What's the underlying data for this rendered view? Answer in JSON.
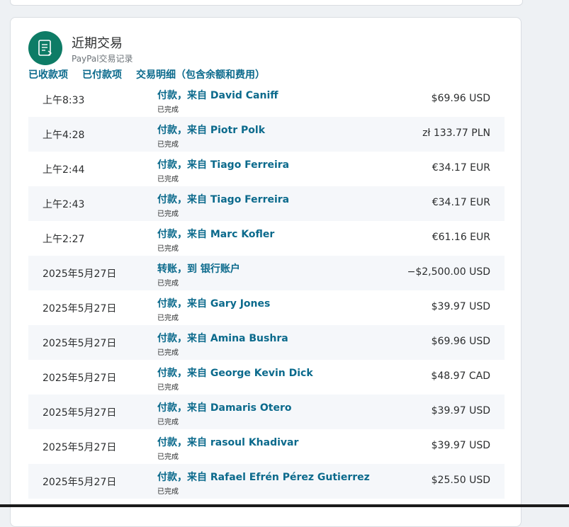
{
  "card": {
    "title": "近期交易",
    "subtitle": "PayPal交易记录",
    "icon": "document-icon"
  },
  "tabs": [
    {
      "label": "已收款项"
    },
    {
      "label": "已付款项"
    },
    {
      "label": "交易明细（包含余额和费用）"
    }
  ],
  "transactions": [
    {
      "date": "上午8:33",
      "description": "付款，来自 David Caniff",
      "status": "已完成",
      "amount": "$69.96 USD"
    },
    {
      "date": "上午4:28",
      "description": "付款，来自 Piotr Polk",
      "status": "已完成",
      "amount": "zł 133.77 PLN"
    },
    {
      "date": "上午2:44",
      "description": "付款，来自 Tiago Ferreira",
      "status": "已完成",
      "amount": "€34.17 EUR"
    },
    {
      "date": "上午2:43",
      "description": "付款，来自 Tiago Ferreira",
      "status": "已完成",
      "amount": "€34.17 EUR"
    },
    {
      "date": "上午2:27",
      "description": "付款，来自 Marc Kofler",
      "status": "已完成",
      "amount": "€61.16 EUR"
    },
    {
      "date": "2025年5月27日",
      "description": "转账，到 银行账户",
      "status": "已完成",
      "amount": "−$2,500.00 USD"
    },
    {
      "date": "2025年5月27日",
      "description": "付款，来自 Gary Jones",
      "status": "已完成",
      "amount": "$39.97 USD"
    },
    {
      "date": "2025年5月27日",
      "description": "付款，来自 Amina Bushra",
      "status": "已完成",
      "amount": "$69.96 USD"
    },
    {
      "date": "2025年5月27日",
      "description": "付款，来自 George Kevin Dick",
      "status": "已完成",
      "amount": "$48.97 CAD"
    },
    {
      "date": "2025年5月27日",
      "description": "付款，来自 Damaris Otero",
      "status": "已完成",
      "amount": "$39.97 USD"
    },
    {
      "date": "2025年5月27日",
      "description": "付款，来自 rasoul Khadivar",
      "status": "已完成",
      "amount": "$39.97 USD"
    },
    {
      "date": "2025年5月27日",
      "description": "付款，来自 Rafael Efrén Pérez Gutierrez",
      "status": "已完成",
      "amount": "$25.50 USD"
    }
  ],
  "colors": {
    "accent": "#0e7c66",
    "link": "#0b6a8c",
    "text": "#2c2e2f",
    "alt_row": "#f5f7fa"
  }
}
